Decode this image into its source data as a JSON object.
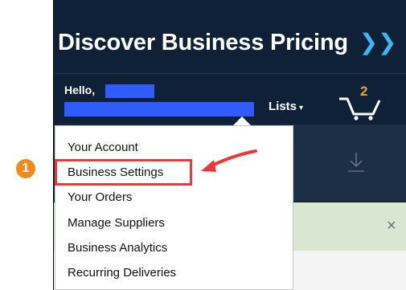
{
  "header": {
    "title_part1": "Discover",
    "title_part2": "Business Pricing",
    "title_chevron": "❯❯"
  },
  "account": {
    "greeting": "Hello,",
    "lists_label": "Lists",
    "lists_caret": "▾"
  },
  "cart": {
    "count": "2"
  },
  "menu": {
    "items": [
      {
        "label": "Your Account"
      },
      {
        "label": "Business Settings"
      },
      {
        "label": "Your Orders"
      },
      {
        "label": "Manage Suppliers"
      },
      {
        "label": "Business Analytics"
      },
      {
        "label": "Recurring Deliveries"
      }
    ]
  },
  "annotation": {
    "step_number": "1"
  },
  "notice": {
    "close_glyph": "×"
  },
  "colors": {
    "header_bg": "#0f2136",
    "accent_chevron": "#3eb6f0",
    "cart_count": "#f2a43a",
    "highlight": "#e83a3a",
    "step_badge": "#ee8a1e",
    "redaction": "#2f5bff"
  }
}
